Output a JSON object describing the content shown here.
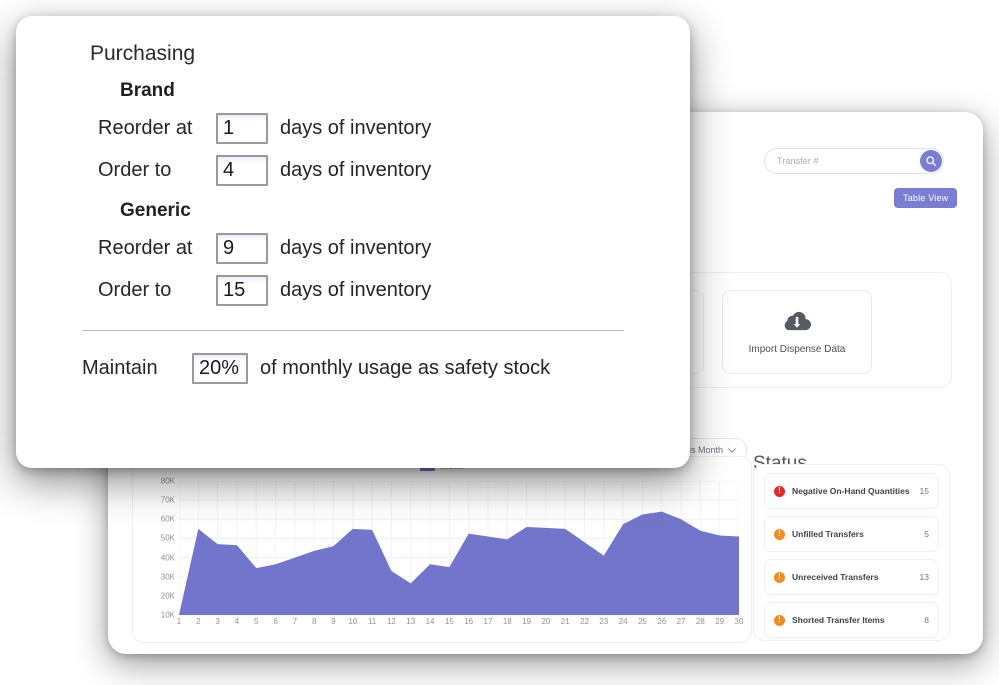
{
  "modal": {
    "title": "Purchasing",
    "sections": [
      {
        "heading": "Brand",
        "rows": [
          {
            "label": "Reorder at",
            "value": "1",
            "suffix": "days of inventory"
          },
          {
            "label": "Order to",
            "value": "4",
            "suffix": "days of inventory"
          }
        ]
      },
      {
        "heading": "Generic",
        "rows": [
          {
            "label": "Reorder at",
            "value": "9",
            "suffix": "days of inventory"
          },
          {
            "label": "Order to",
            "value": "15",
            "suffix": "days of inventory"
          }
        ]
      }
    ],
    "safety_stock": {
      "label": "Maintain",
      "value": "20%",
      "suffix": "of monthly usage as safety stock"
    }
  },
  "app": {
    "search": {
      "placeholder": "Transfer #",
      "value": "",
      "icon": "search-icon"
    },
    "table_view_label": "Table View",
    "import_tile": {
      "label": "Import Dispense Data",
      "icon": "cloud-upload-icon"
    },
    "period_filter": {
      "value": "is Month",
      "icon": "chevron-down-icon"
    },
    "status": {
      "title": "Status",
      "items": [
        {
          "label": "Negative On-Hand Quantities",
          "count": "15",
          "color": "#e02b27",
          "icon": "alert-circle-icon"
        },
        {
          "label": "Unfilled Transfers",
          "count": "5",
          "color": "#f08a24",
          "icon": "alert-circle-icon"
        },
        {
          "label": "Unreceived Transfers",
          "count": "13",
          "color": "#f08a24",
          "icon": "alert-circle-icon"
        },
        {
          "label": "Shorted Transfer Items",
          "count": "8",
          "color": "#f08a24",
          "icon": "alert-circle-icon"
        }
      ]
    }
  },
  "colors": {
    "accent_purple": "#7b7cd4",
    "chart_fill": "#7375cc",
    "status_red": "#e02b27",
    "status_orange": "#f08a24"
  },
  "chart_data": {
    "type": "area",
    "title": "",
    "xlabel": "",
    "ylabel": "",
    "legend": [
      "Counter"
    ],
    "legend_position": "top-center",
    "grid": true,
    "ylim": [
      10000,
      80000
    ],
    "ytick_labels": [
      "10K",
      "20K",
      "30K",
      "40K",
      "50K",
      "60K",
      "70K",
      "80K"
    ],
    "yticks": [
      10000,
      20000,
      30000,
      40000,
      50000,
      60000,
      70000,
      80000
    ],
    "categories": [
      1,
      2,
      3,
      4,
      5,
      6,
      7,
      8,
      9,
      10,
      11,
      12,
      13,
      14,
      15,
      16,
      17,
      18,
      19,
      20,
      21,
      22,
      23,
      24,
      25,
      26,
      27,
      28,
      29,
      30
    ],
    "series": [
      {
        "name": "Counter",
        "values": [
          10000,
          55000,
          47000,
          46500,
          34500,
          36500,
          40000,
          43500,
          46000,
          55000,
          54500,
          33000,
          26500,
          36500,
          35000,
          52500,
          51000,
          49500,
          56000,
          55500,
          55000,
          48000,
          41000,
          57500,
          62500,
          64000,
          60000,
          54000,
          51500,
          51000
        ]
      }
    ]
  }
}
